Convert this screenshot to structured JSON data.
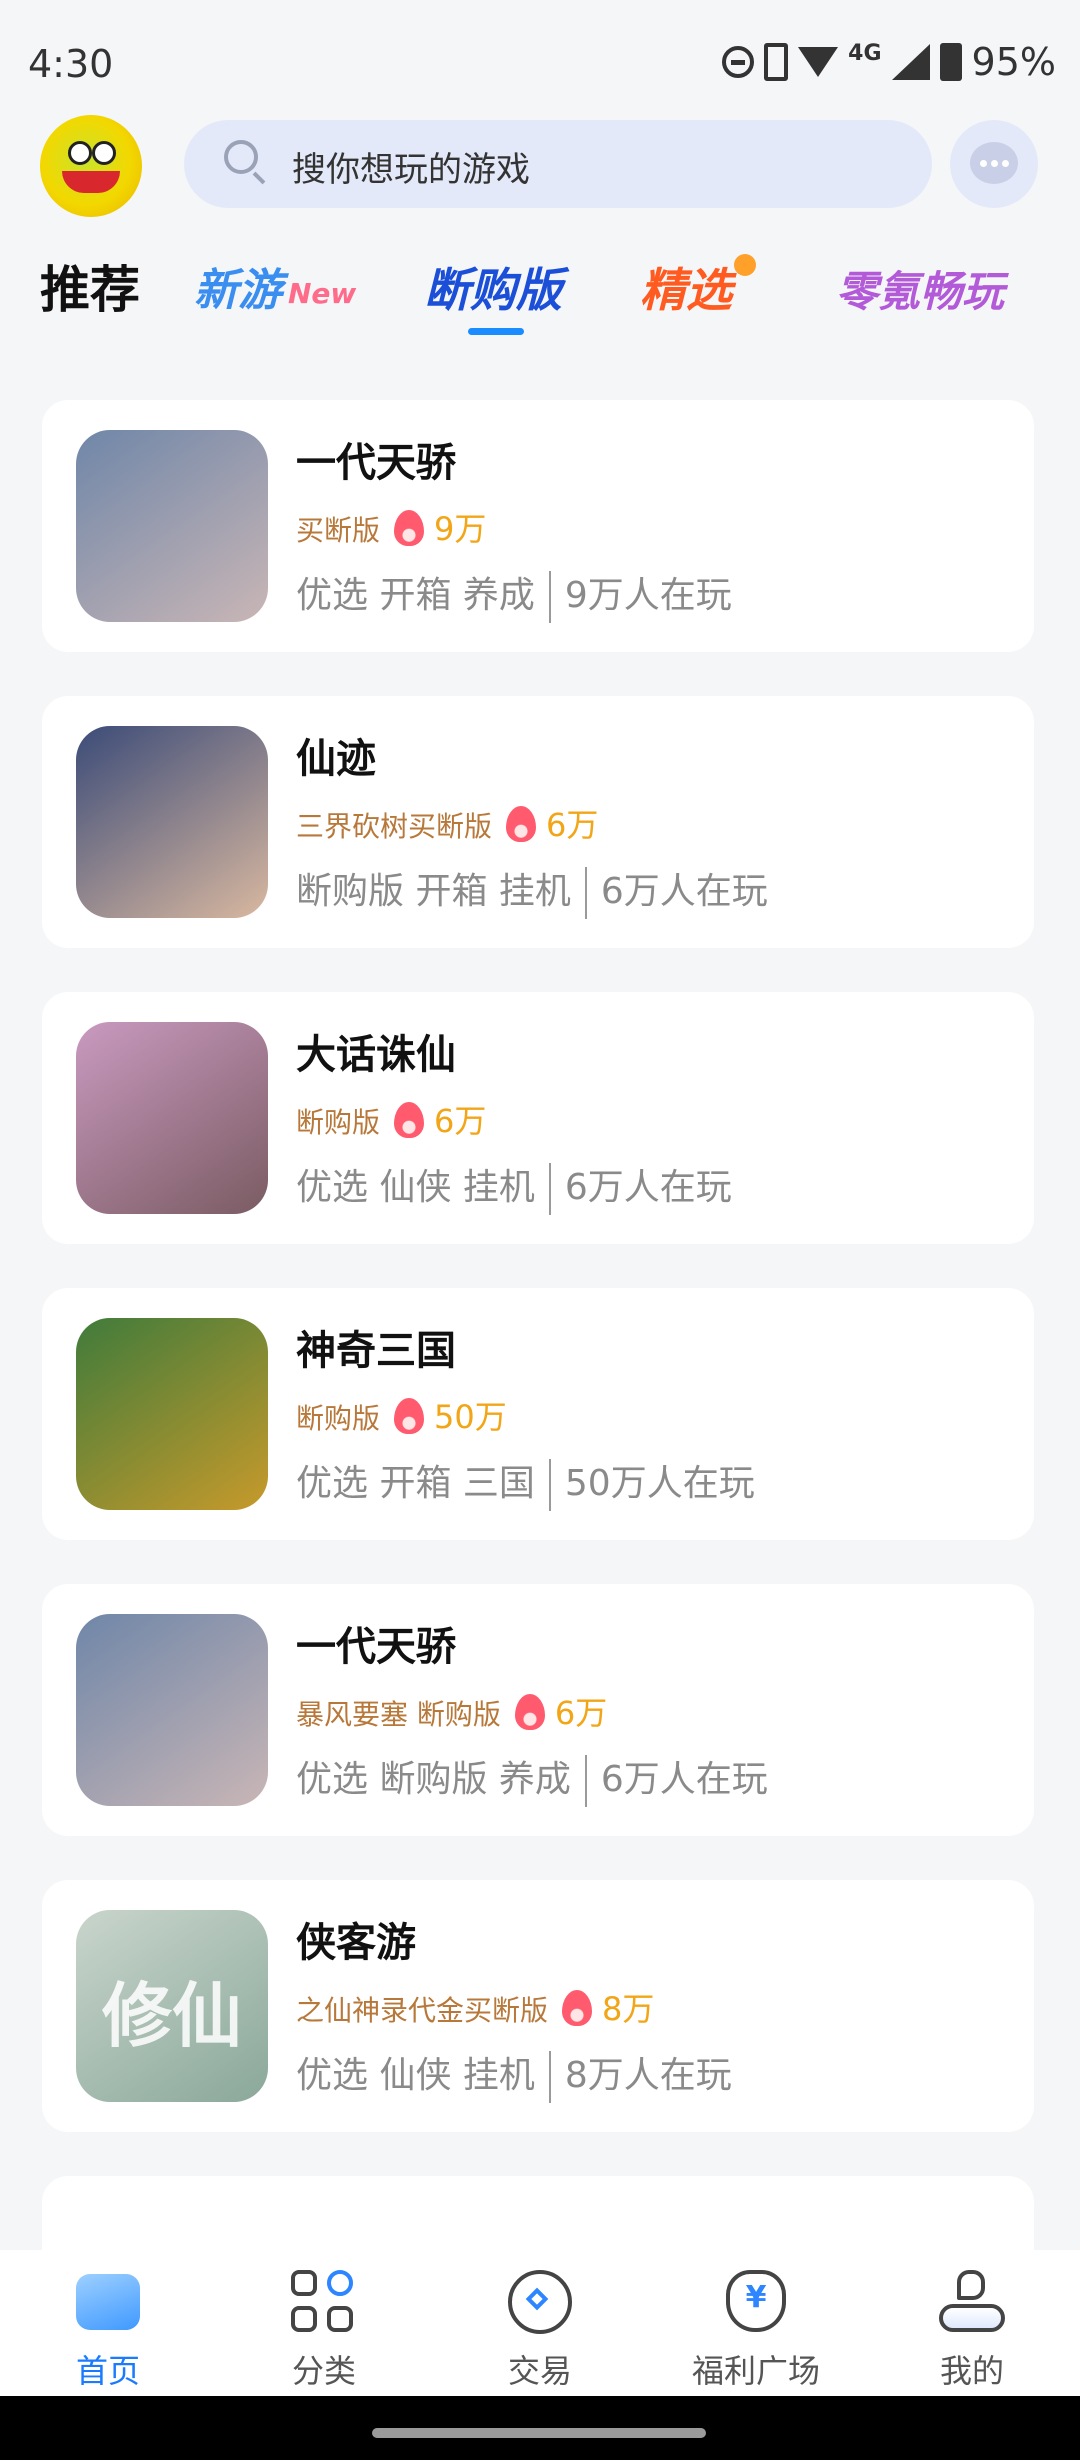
{
  "status_bar": {
    "time": "4:30",
    "network": "4G",
    "battery": "95%"
  },
  "header": {
    "search_placeholder": "搜你想玩的游戏"
  },
  "tabs": [
    {
      "label": "推荐"
    },
    {
      "label": "新游",
      "badge": "New"
    },
    {
      "label": "断购版",
      "active": true
    },
    {
      "label": "精选"
    },
    {
      "label": "零氪畅玩"
    }
  ],
  "games": [
    {
      "title": "一代天骄",
      "tag": "买断版",
      "hot": "9万",
      "meta": "优选 开箱 养成",
      "players": "9万人在玩",
      "thumb_colors": [
        "#6f86a8",
        "#c9b6b6"
      ]
    },
    {
      "title": "仙迹",
      "tag": "三界砍树买断版",
      "hot": "6万",
      "meta": "断购版 开箱 挂机",
      "players": "6万人在玩",
      "thumb_colors": [
        "#3b4b78",
        "#d9b8a0"
      ]
    },
    {
      "title": "大话诛仙",
      "tag": "断购版",
      "hot": "6万",
      "meta": "优选 仙侠 挂机",
      "players": "6万人在玩",
      "thumb_colors": [
        "#c99ac0",
        "#7a5b62"
      ]
    },
    {
      "title": "神奇三国",
      "tag": "断购版",
      "hot": "50万",
      "meta": "优选 开箱 三国",
      "players": "50万人在玩",
      "thumb_colors": [
        "#3f7b3b",
        "#c79a2b"
      ]
    },
    {
      "title": "一代天骄",
      "tag": "暴风要塞 断购版",
      "hot": "6万",
      "meta": "优选 断购版 养成",
      "players": "6万人在玩",
      "thumb_colors": [
        "#6f86a8",
        "#c9b6b6"
      ]
    },
    {
      "title": "侠客游",
      "tag": "之仙神录代金买断版",
      "hot": "8万",
      "meta": "优选 仙侠 挂机",
      "players": "8万人在玩",
      "thumb_colors": [
        "#c9d5cc",
        "#8aa89a"
      ],
      "thumb_glyph": "修仙"
    }
  ],
  "bottom_nav": [
    {
      "label": "首页",
      "icon": "home-icon",
      "active": true
    },
    {
      "label": "分类",
      "icon": "category-icon"
    },
    {
      "label": "交易",
      "icon": "trade-icon"
    },
    {
      "label": "福利广场",
      "icon": "welfare-icon"
    },
    {
      "label": "我的",
      "icon": "profile-icon"
    }
  ],
  "colors": {
    "accent": "#1a7bff",
    "tag": "#b7783a",
    "hot": "#f2a516"
  }
}
